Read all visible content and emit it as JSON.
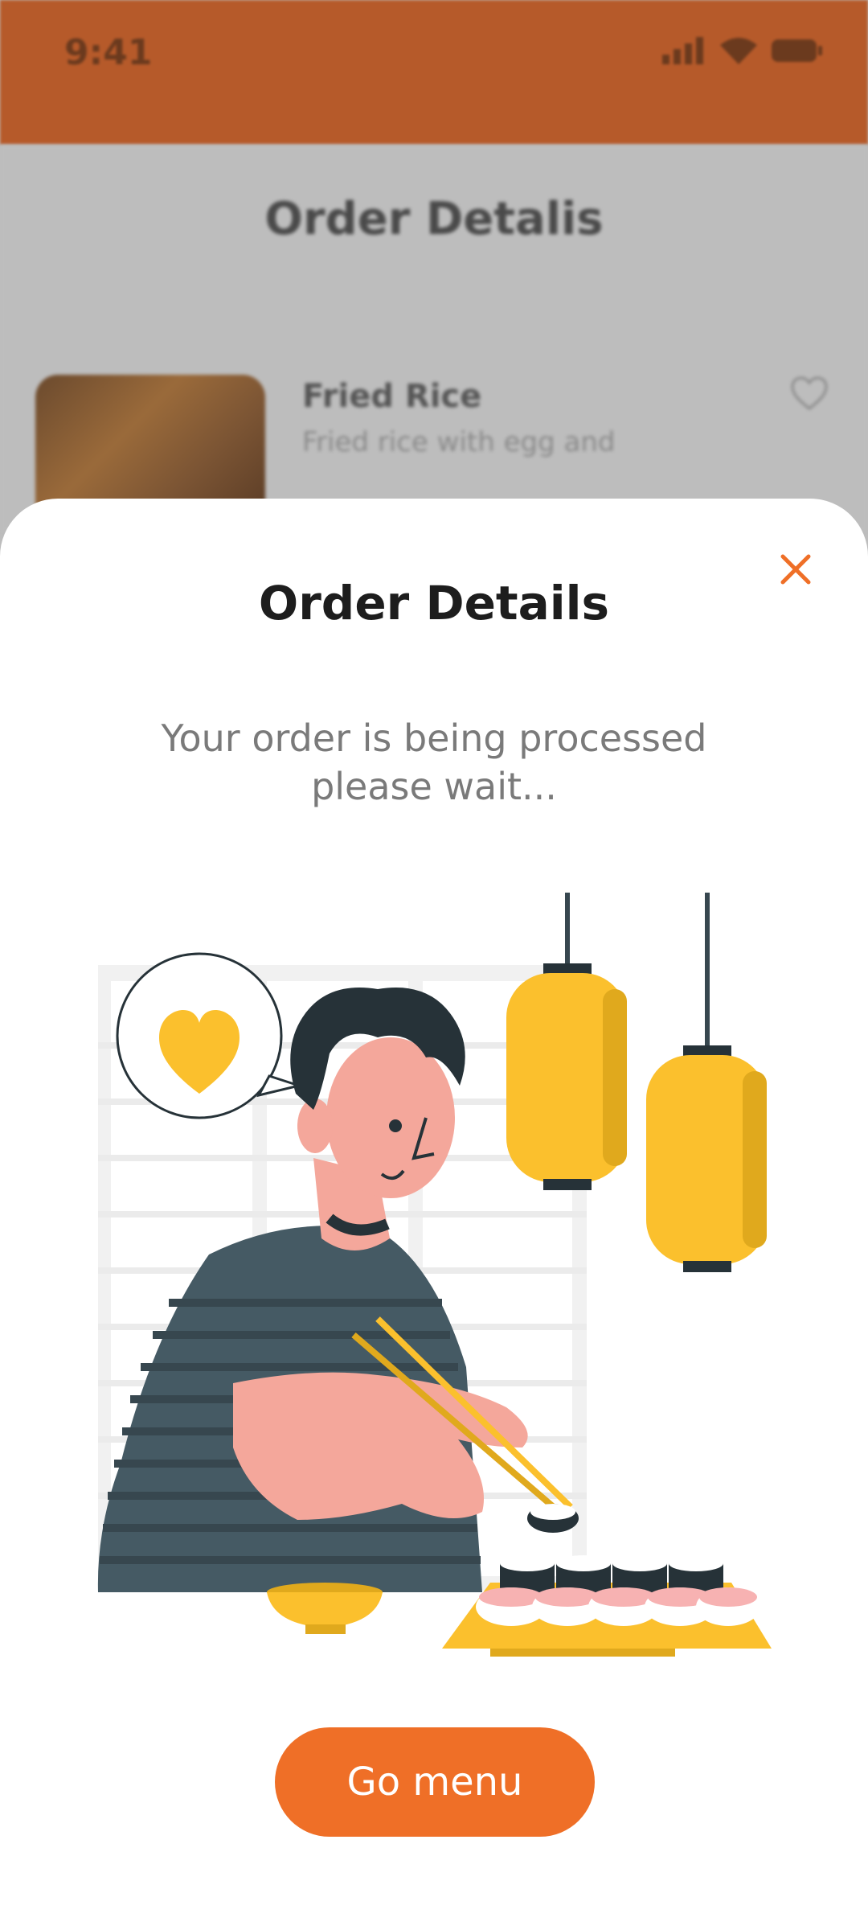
{
  "status_bar": {
    "time": "9:41",
    "icons": [
      "signal-icon",
      "wifi-icon",
      "battery-icon"
    ]
  },
  "background_screen": {
    "title": "Order Detalis",
    "item": {
      "name": "Fried Rice",
      "description": "Fried rice with egg and"
    }
  },
  "sheet": {
    "title": "Order Details",
    "message_line1": "Your order is being processed",
    "message_line2": "please wait...",
    "button_label": "Go menu"
  },
  "colors": {
    "accent": "#ef6f27",
    "status_bar": "#b65a2a",
    "yellow": "#fbc02d",
    "dark": "#263238"
  }
}
